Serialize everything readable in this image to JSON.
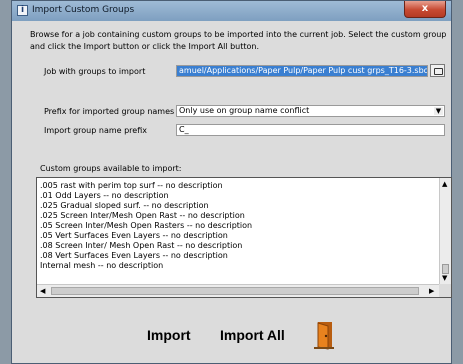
{
  "window": {
    "title": "Import Custom Groups",
    "close_symbol": "x"
  },
  "description": "Browse for a job containing custom groups to be imported into the current job. Select the custom group and click the Import button or click the Import All button.",
  "job_field": {
    "label": "Job with groups to import",
    "value": "amuel/Applications/Paper Pulp/Paper Pulp cust grps_T16-3.sbc"
  },
  "prefix_select": {
    "label": "Prefix for imported group names",
    "value": "Only use on group name conflict"
  },
  "prefix_input": {
    "label": "Import group name prefix",
    "value": "C_"
  },
  "groups_list": {
    "label": "Custom groups available to import:",
    "items": [
      ".005 rast with perim top surf  -- no description",
      ".01 Odd Layers  -- no description",
      ".025 Gradual sloped surf.  -- no description",
      ".025 Screen Inter/Mesh Open Rast  -- no description",
      ".05 Screen Inter/Mesh Open Rasters  -- no description",
      ".05 Vert Surfaces Even Layers  -- no description",
      ".08 Screen Inter/ Mesh Open Rast  -- no description",
      ".08 Vert Surfaces Even Layers  -- no description",
      "Internal mesh  -- no description"
    ]
  },
  "actions": {
    "import_label": "Import",
    "import_all_label": "Import All"
  },
  "icons": {
    "app": "info-icon",
    "browse": "folder-icon",
    "exit": "exit-door-icon"
  },
  "colors": {
    "selection": "#3a7fd1",
    "close_button": "#c74a32",
    "exit_door": "#e8821e"
  }
}
